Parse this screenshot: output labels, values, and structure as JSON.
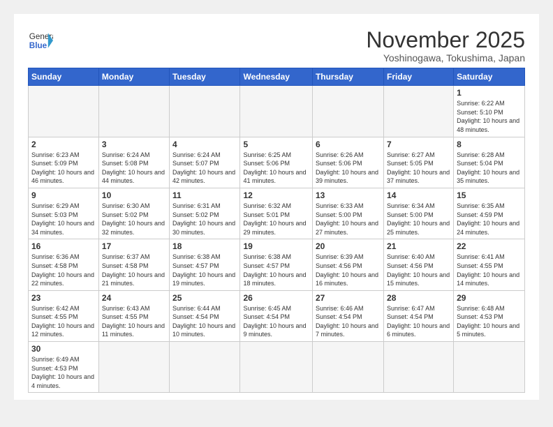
{
  "logo": {
    "text_normal": "General",
    "text_bold": "Blue"
  },
  "title": "November 2025",
  "location": "Yoshinogawa, Tokushima, Japan",
  "weekdays": [
    "Sunday",
    "Monday",
    "Tuesday",
    "Wednesday",
    "Thursday",
    "Friday",
    "Saturday"
  ],
  "weeks": [
    [
      {
        "day": "",
        "info": ""
      },
      {
        "day": "",
        "info": ""
      },
      {
        "day": "",
        "info": ""
      },
      {
        "day": "",
        "info": ""
      },
      {
        "day": "",
        "info": ""
      },
      {
        "day": "",
        "info": ""
      },
      {
        "day": "1",
        "info": "Sunrise: 6:22 AM\nSunset: 5:10 PM\nDaylight: 10 hours and 48 minutes."
      }
    ],
    [
      {
        "day": "2",
        "info": "Sunrise: 6:23 AM\nSunset: 5:09 PM\nDaylight: 10 hours and 46 minutes."
      },
      {
        "day": "3",
        "info": "Sunrise: 6:24 AM\nSunset: 5:08 PM\nDaylight: 10 hours and 44 minutes."
      },
      {
        "day": "4",
        "info": "Sunrise: 6:24 AM\nSunset: 5:07 PM\nDaylight: 10 hours and 42 minutes."
      },
      {
        "day": "5",
        "info": "Sunrise: 6:25 AM\nSunset: 5:06 PM\nDaylight: 10 hours and 41 minutes."
      },
      {
        "day": "6",
        "info": "Sunrise: 6:26 AM\nSunset: 5:06 PM\nDaylight: 10 hours and 39 minutes."
      },
      {
        "day": "7",
        "info": "Sunrise: 6:27 AM\nSunset: 5:05 PM\nDaylight: 10 hours and 37 minutes."
      },
      {
        "day": "8",
        "info": "Sunrise: 6:28 AM\nSunset: 5:04 PM\nDaylight: 10 hours and 35 minutes."
      }
    ],
    [
      {
        "day": "9",
        "info": "Sunrise: 6:29 AM\nSunset: 5:03 PM\nDaylight: 10 hours and 34 minutes."
      },
      {
        "day": "10",
        "info": "Sunrise: 6:30 AM\nSunset: 5:02 PM\nDaylight: 10 hours and 32 minutes."
      },
      {
        "day": "11",
        "info": "Sunrise: 6:31 AM\nSunset: 5:02 PM\nDaylight: 10 hours and 30 minutes."
      },
      {
        "day": "12",
        "info": "Sunrise: 6:32 AM\nSunset: 5:01 PM\nDaylight: 10 hours and 29 minutes."
      },
      {
        "day": "13",
        "info": "Sunrise: 6:33 AM\nSunset: 5:00 PM\nDaylight: 10 hours and 27 minutes."
      },
      {
        "day": "14",
        "info": "Sunrise: 6:34 AM\nSunset: 5:00 PM\nDaylight: 10 hours and 25 minutes."
      },
      {
        "day": "15",
        "info": "Sunrise: 6:35 AM\nSunset: 4:59 PM\nDaylight: 10 hours and 24 minutes."
      }
    ],
    [
      {
        "day": "16",
        "info": "Sunrise: 6:36 AM\nSunset: 4:58 PM\nDaylight: 10 hours and 22 minutes."
      },
      {
        "day": "17",
        "info": "Sunrise: 6:37 AM\nSunset: 4:58 PM\nDaylight: 10 hours and 21 minutes."
      },
      {
        "day": "18",
        "info": "Sunrise: 6:38 AM\nSunset: 4:57 PM\nDaylight: 10 hours and 19 minutes."
      },
      {
        "day": "19",
        "info": "Sunrise: 6:38 AM\nSunset: 4:57 PM\nDaylight: 10 hours and 18 minutes."
      },
      {
        "day": "20",
        "info": "Sunrise: 6:39 AM\nSunset: 4:56 PM\nDaylight: 10 hours and 16 minutes."
      },
      {
        "day": "21",
        "info": "Sunrise: 6:40 AM\nSunset: 4:56 PM\nDaylight: 10 hours and 15 minutes."
      },
      {
        "day": "22",
        "info": "Sunrise: 6:41 AM\nSunset: 4:55 PM\nDaylight: 10 hours and 14 minutes."
      }
    ],
    [
      {
        "day": "23",
        "info": "Sunrise: 6:42 AM\nSunset: 4:55 PM\nDaylight: 10 hours and 12 minutes."
      },
      {
        "day": "24",
        "info": "Sunrise: 6:43 AM\nSunset: 4:55 PM\nDaylight: 10 hours and 11 minutes."
      },
      {
        "day": "25",
        "info": "Sunrise: 6:44 AM\nSunset: 4:54 PM\nDaylight: 10 hours and 10 minutes."
      },
      {
        "day": "26",
        "info": "Sunrise: 6:45 AM\nSunset: 4:54 PM\nDaylight: 10 hours and 9 minutes."
      },
      {
        "day": "27",
        "info": "Sunrise: 6:46 AM\nSunset: 4:54 PM\nDaylight: 10 hours and 7 minutes."
      },
      {
        "day": "28",
        "info": "Sunrise: 6:47 AM\nSunset: 4:54 PM\nDaylight: 10 hours and 6 minutes."
      },
      {
        "day": "29",
        "info": "Sunrise: 6:48 AM\nSunset: 4:53 PM\nDaylight: 10 hours and 5 minutes."
      }
    ],
    [
      {
        "day": "30",
        "info": "Sunrise: 6:49 AM\nSunset: 4:53 PM\nDaylight: 10 hours and 4 minutes."
      },
      {
        "day": "",
        "info": ""
      },
      {
        "day": "",
        "info": ""
      },
      {
        "day": "",
        "info": ""
      },
      {
        "day": "",
        "info": ""
      },
      {
        "day": "",
        "info": ""
      },
      {
        "day": "",
        "info": ""
      }
    ]
  ]
}
